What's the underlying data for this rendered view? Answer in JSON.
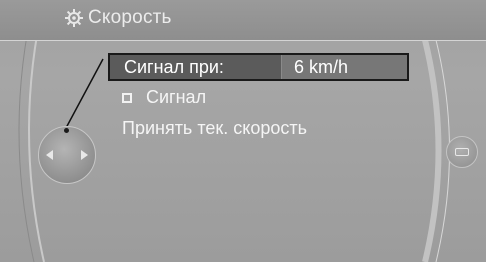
{
  "title": {
    "text": "Скорость",
    "icon": "settings-gear-icon"
  },
  "menu": {
    "signal_at": {
      "label": "Сигнал при:",
      "value": "6 km/h"
    },
    "signal_toggle": {
      "label": "Сигнал",
      "checked": false
    },
    "accept_speed": {
      "label": "Принять тек. скорость"
    }
  },
  "controller": {
    "icon": "controller-arrows-icon"
  },
  "side_button": {
    "icon": "options-tab-icon"
  },
  "colors": {
    "background": "#a4a4a4",
    "selection": "#5b5b5b",
    "value_cell": "#777777",
    "text": "#ffffff"
  }
}
